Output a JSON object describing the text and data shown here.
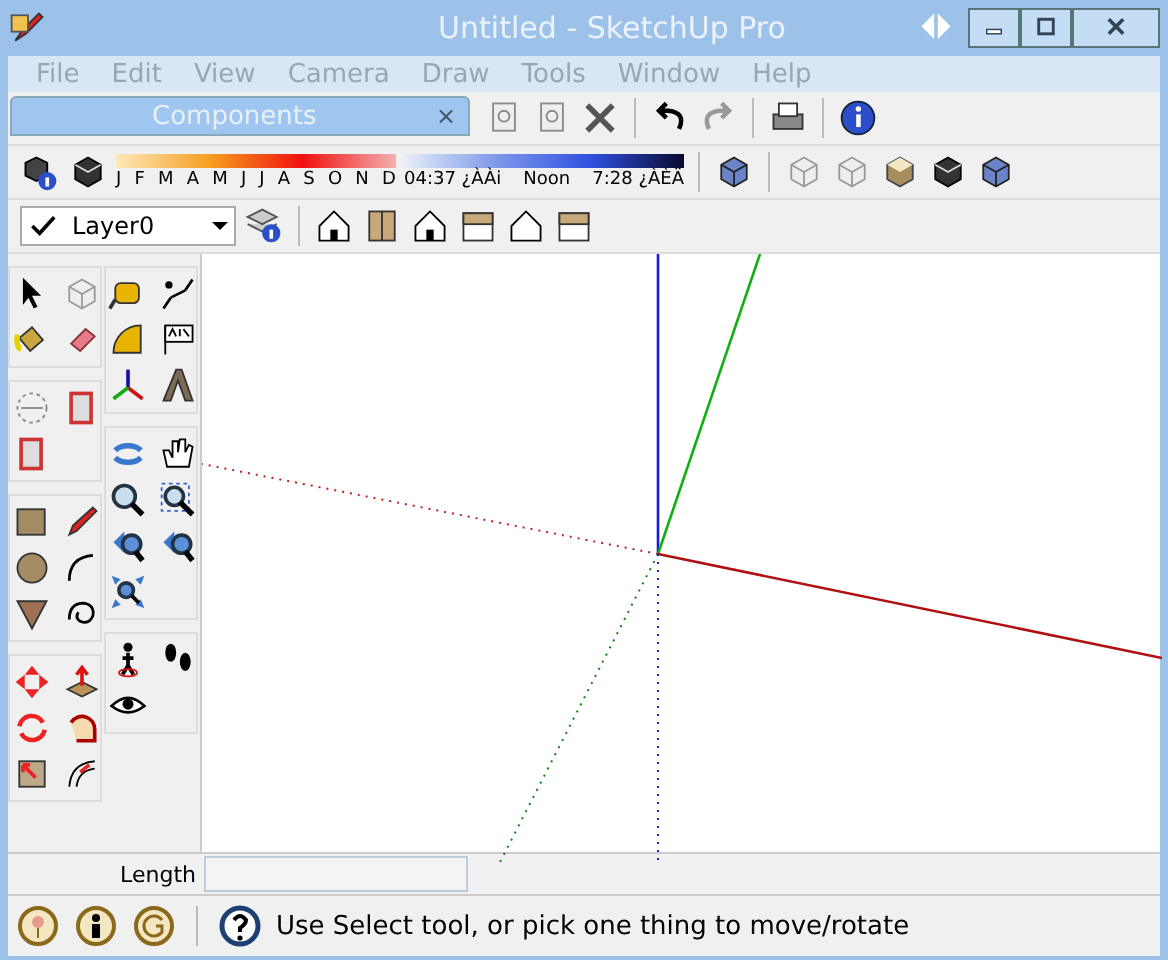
{
  "window": {
    "title": "Untitled - SketchUp Pro"
  },
  "menu": [
    {
      "label": "File",
      "disabled": true
    },
    {
      "label": "Edit",
      "disabled": true
    },
    {
      "label": "View",
      "disabled": true
    },
    {
      "label": "Camera",
      "disabled": true
    },
    {
      "label": "Draw",
      "disabled": true
    },
    {
      "label": "Tools",
      "disabled": true
    },
    {
      "label": "Window",
      "disabled": true
    },
    {
      "label": "Help",
      "disabled": true
    }
  ],
  "components_panel": {
    "title": "Components",
    "close": "×"
  },
  "shadow_settings": {
    "months": [
      "J",
      "F",
      "M",
      "A",
      "M",
      "J",
      "J",
      "A",
      "S",
      "O",
      "N",
      "D"
    ],
    "times": [
      "04:37 ¿ÀÀi",
      "Noon",
      "7:28 ¿ÀÈÄ"
    ]
  },
  "layer_select": {
    "value": "Layer0"
  },
  "measurements": {
    "label": "Length"
  },
  "status_bar": {
    "message": "Use Select tool, or pick one thing to move/rotate"
  }
}
